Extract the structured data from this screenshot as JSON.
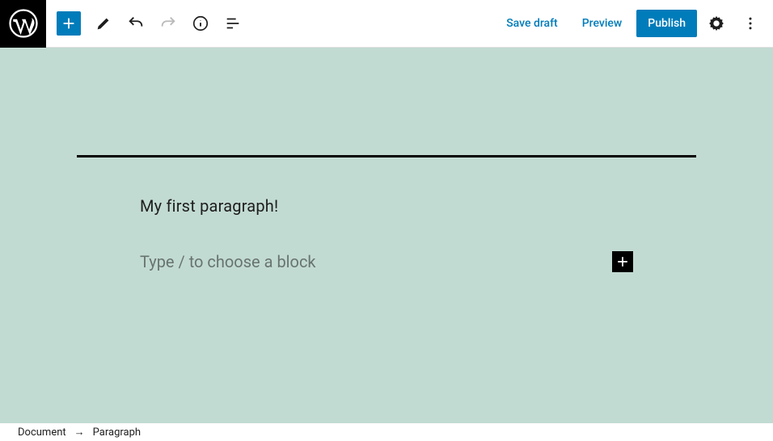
{
  "header": {
    "save_draft": "Save draft",
    "preview": "Preview",
    "publish": "Publish"
  },
  "editor": {
    "paragraph": "My first paragraph!",
    "placeholder": "Type / to choose a block"
  },
  "breadcrumb": {
    "root": "Document",
    "current": "Paragraph"
  }
}
